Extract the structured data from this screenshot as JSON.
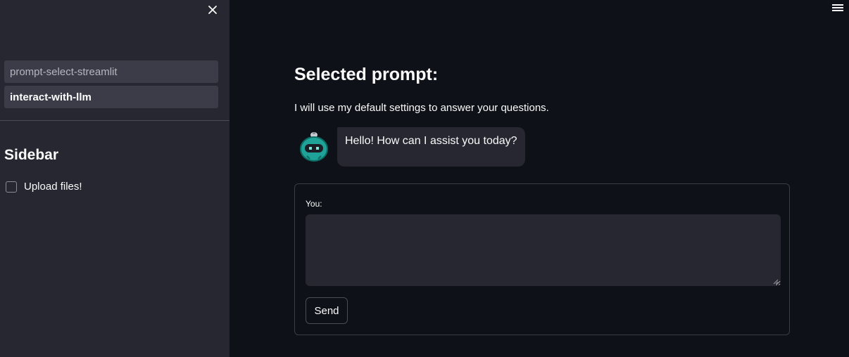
{
  "sidebar": {
    "nav_items": [
      {
        "label": "prompt-select-streamlit",
        "active": false
      },
      {
        "label": "interact-with-llm",
        "active": true
      }
    ],
    "title": "Sidebar",
    "upload_checkbox": {
      "label": "Upload files!",
      "checked": false
    },
    "close_icon": "close-icon"
  },
  "header": {
    "menu_icon": "hamburger-menu-icon"
  },
  "main": {
    "title": "Selected prompt:",
    "info": "I will use my default settings to answer your questions.",
    "assistant_message": "Hello! How can I assist you today?",
    "avatar_icon": "robot-avatar-icon",
    "form": {
      "input_label": "You:",
      "input_value": "",
      "send_label": "Send"
    }
  },
  "colors": {
    "main_background": "#0e1117",
    "sidebar_background": "#262730",
    "avatar_teal": "#1fa398"
  }
}
